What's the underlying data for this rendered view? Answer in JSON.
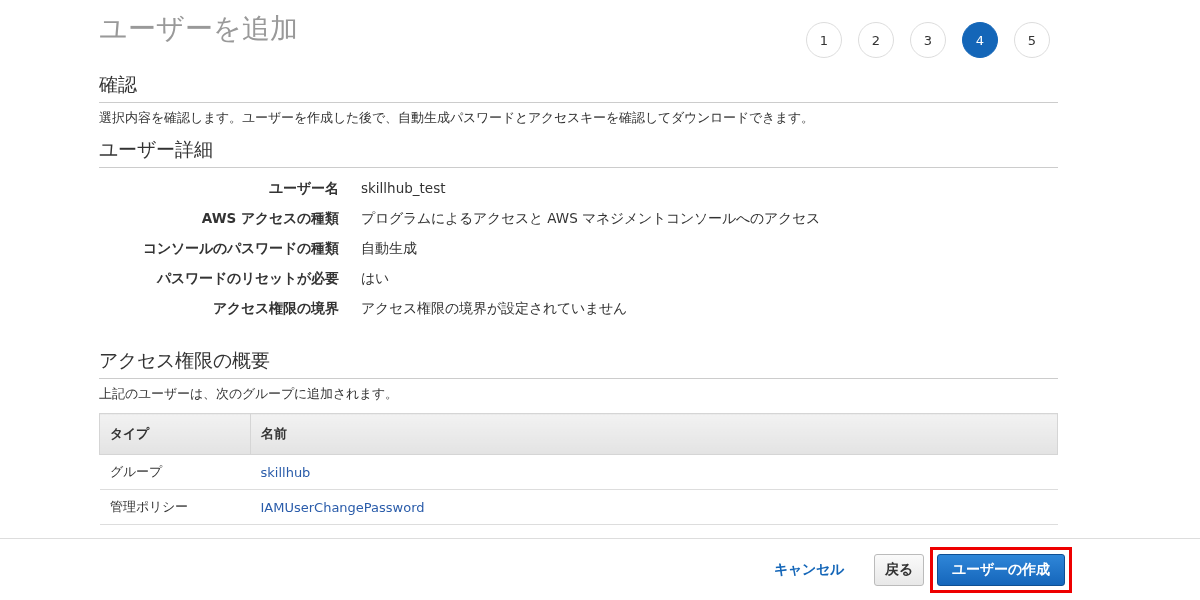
{
  "title": "ユーザーを追加",
  "steps": [
    {
      "label": "1",
      "selected": false
    },
    {
      "label": "2",
      "selected": false
    },
    {
      "label": "3",
      "selected": false
    },
    {
      "label": "4",
      "selected": true
    },
    {
      "label": "5",
      "selected": false
    }
  ],
  "review": {
    "heading": "確認",
    "description": "選択内容を確認します。ユーザーを作成した後で、自動生成パスワードとアクセスキーを確認してダウンロードできます。"
  },
  "user_details": {
    "heading": "ユーザー詳細",
    "fields": [
      {
        "label": "ユーザー名",
        "value": "skillhub_test"
      },
      {
        "label": "AWS アクセスの種類",
        "value": "プログラムによるアクセスと AWS マネジメントコンソールへのアクセス"
      },
      {
        "label": "コンソールのパスワードの種類",
        "value": "自動生成"
      },
      {
        "label": "パスワードのリセットが必要",
        "value": "はい"
      },
      {
        "label": "アクセス権限の境界",
        "value": "アクセス権限の境界が設定されていません"
      }
    ]
  },
  "permissions": {
    "heading": "アクセス権限の概要",
    "description": "上記のユーザーは、次のグループに追加されます。",
    "table": {
      "columns": [
        "タイプ",
        "名前"
      ],
      "rows": [
        {
          "type": "グループ",
          "name": "skillhub"
        },
        {
          "type": "管理ポリシー",
          "name": "IAMUserChangePassword"
        }
      ]
    }
  },
  "footer": {
    "cancel": "キャンセル",
    "back": "戻る",
    "create": {
      "label": "ユーザーの作成",
      "highlighted": true
    }
  }
}
